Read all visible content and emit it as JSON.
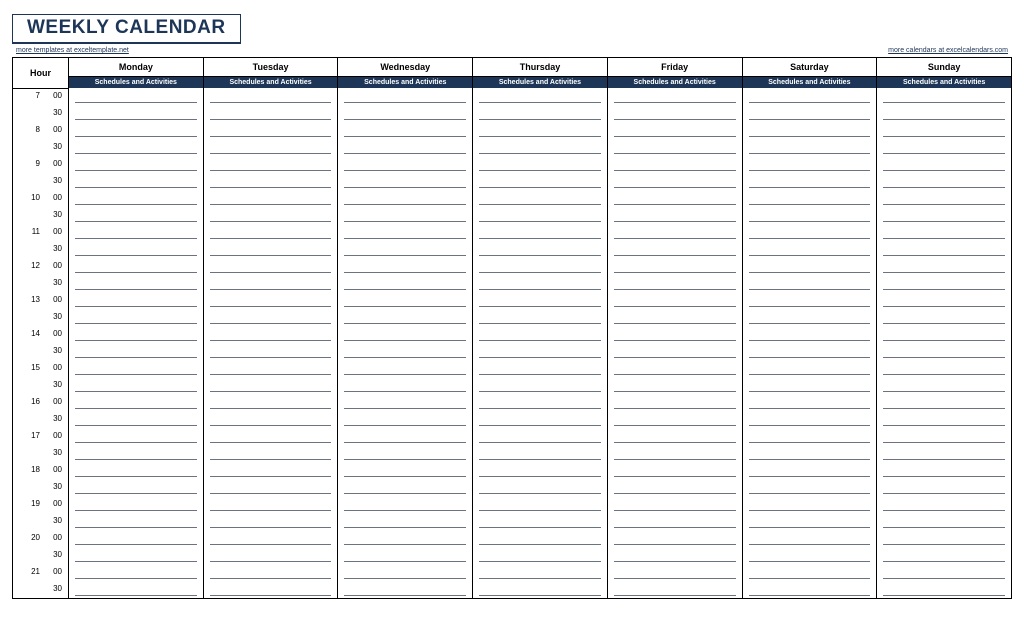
{
  "title": "WEEKLY CALENDAR",
  "links": {
    "left": "more templates at exceltemplate.net",
    "right": "more calendars at excelcalendars.com"
  },
  "header": {
    "hour_label": "Hour",
    "days": [
      "Monday",
      "Tuesday",
      "Wednesday",
      "Thursday",
      "Friday",
      "Saturday",
      "Sunday"
    ],
    "sub_label": "Schedules and Activities"
  },
  "time_rows": [
    {
      "hour": "7",
      "minute": "00"
    },
    {
      "hour": "",
      "minute": "30"
    },
    {
      "hour": "8",
      "minute": "00"
    },
    {
      "hour": "",
      "minute": "30"
    },
    {
      "hour": "9",
      "minute": "00"
    },
    {
      "hour": "",
      "minute": "30"
    },
    {
      "hour": "10",
      "minute": "00"
    },
    {
      "hour": "",
      "minute": "30"
    },
    {
      "hour": "11",
      "minute": "00"
    },
    {
      "hour": "",
      "minute": "30"
    },
    {
      "hour": "12",
      "minute": "00"
    },
    {
      "hour": "",
      "minute": "30"
    },
    {
      "hour": "13",
      "minute": "00"
    },
    {
      "hour": "",
      "minute": "30"
    },
    {
      "hour": "14",
      "minute": "00"
    },
    {
      "hour": "",
      "minute": "30"
    },
    {
      "hour": "15",
      "minute": "00"
    },
    {
      "hour": "",
      "minute": "30"
    },
    {
      "hour": "16",
      "minute": "00"
    },
    {
      "hour": "",
      "minute": "30"
    },
    {
      "hour": "17",
      "minute": "00"
    },
    {
      "hour": "",
      "minute": "30"
    },
    {
      "hour": "18",
      "minute": "00"
    },
    {
      "hour": "",
      "minute": "30"
    },
    {
      "hour": "19",
      "minute": "00"
    },
    {
      "hour": "",
      "minute": "30"
    },
    {
      "hour": "20",
      "minute": "00"
    },
    {
      "hour": "",
      "minute": "30"
    },
    {
      "hour": "21",
      "minute": "00"
    },
    {
      "hour": "",
      "minute": "30"
    }
  ]
}
